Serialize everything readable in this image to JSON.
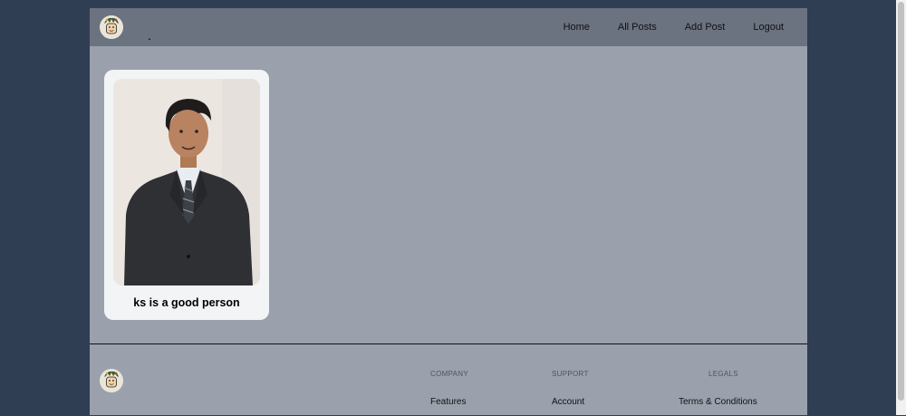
{
  "header": {
    "brand_dot": ".",
    "logo_icon": "avatar-logo-icon",
    "nav": [
      {
        "label": "Home"
      },
      {
        "label": "All Posts"
      },
      {
        "label": "Add Post"
      },
      {
        "label": "Logout"
      }
    ]
  },
  "post": {
    "title": "ks is a good person",
    "image_icon": "person-photo"
  },
  "footer": {
    "columns": [
      {
        "heading": "Company",
        "link": "Features"
      },
      {
        "heading": "Support",
        "link": "Account"
      },
      {
        "heading": "Legals",
        "link": "Terms & Conditions"
      }
    ]
  },
  "colors": {
    "page_bg": "#2f3e52",
    "app_bg": "#9aa1ad",
    "header_bg": "#6b7280",
    "card_bg": "#f3f4f6"
  }
}
